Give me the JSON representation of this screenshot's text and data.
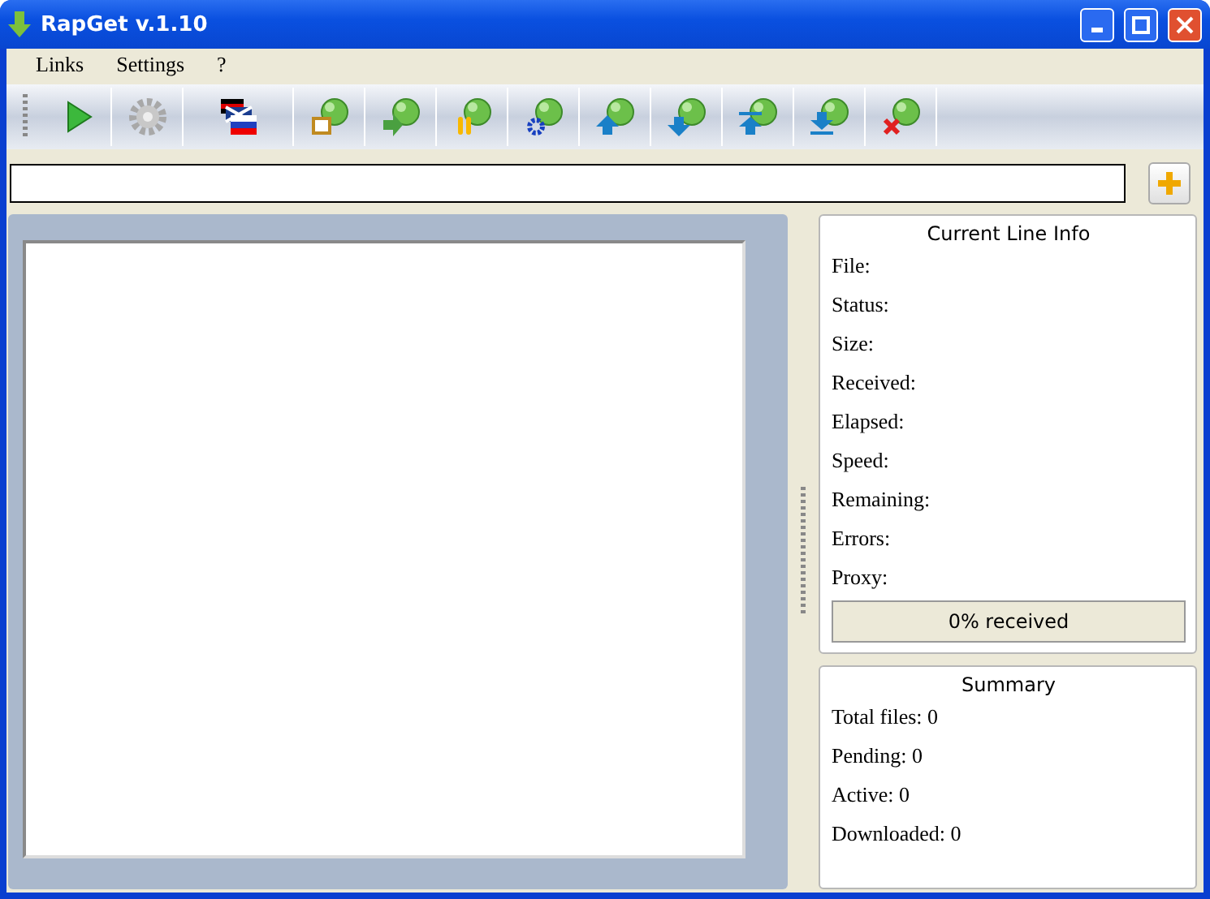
{
  "window": {
    "title": "RapGet v.1.10"
  },
  "menu": [
    "Links",
    "Settings",
    "?"
  ],
  "toolbar": [
    {
      "kind": "play"
    },
    {
      "kind": "settings"
    },
    {
      "kind": "language"
    },
    {
      "kind": "ball-window"
    },
    {
      "kind": "ball-arrow"
    },
    {
      "kind": "ball-pause"
    },
    {
      "kind": "ball-gear"
    },
    {
      "kind": "ball-up"
    },
    {
      "kind": "ball-down"
    },
    {
      "kind": "ball-top"
    },
    {
      "kind": "ball-bottom"
    },
    {
      "kind": "ball-delete"
    }
  ],
  "current_line_info": {
    "title": "Current Line Info",
    "fields": [
      "File:",
      "Status:",
      "Size:",
      "Received:",
      "Elapsed:",
      "Speed:",
      "Remaining:",
      "Errors:",
      "Proxy:"
    ],
    "progress": {
      "level": 0,
      "reading": "0% received"
    }
  },
  "summary": {
    "title": "Summary",
    "fields": [
      "Total files: 0",
      "Pending: 0",
      "Active: 0",
      "Downloaded: 0"
    ]
  }
}
